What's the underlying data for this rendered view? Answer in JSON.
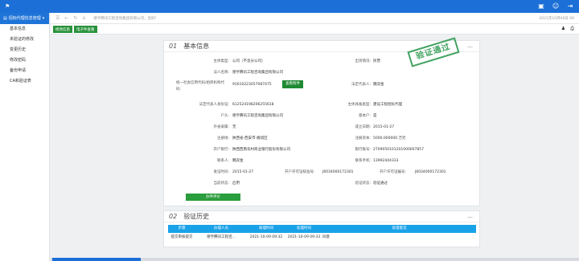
{
  "topbar": {
    "icons": [
      "monitor-icon",
      "user-icon",
      "exit-icon"
    ]
  },
  "sidebar": {
    "header": "招标代理信息管理",
    "items": [
      "基本信息",
      "未验证的修改",
      "变更历史",
      "修改密码",
      "备份申请",
      "CA和验证表"
    ]
  },
  "crumb": {
    "title": "德亨腾讯工程咨询集团有限公司，您好!",
    "date": "2021年10月09日 09"
  },
  "toolbar": {
    "btn1": "修改信息",
    "btn2": "电子件查看"
  },
  "basic": {
    "num": "01",
    "title": "基本信息",
    "stamp": "验证通过",
    "view_btn": "查看附件",
    "eval_btn": "办件评价",
    "fields": [
      {
        "label": "主体类型:",
        "value": "公司（不含分公司）",
        "label2": "出资情况:",
        "value2": "民营"
      },
      {
        "label": "法人名称:",
        "value": "德亨腾讯工程咨询集团有限公司",
        "label2": "",
        "value2": ""
      },
      {
        "label": "统一社会信用代码/组织机构代码:",
        "value": "91610223057087475",
        "label2": "法定代表人:",
        "value2": "魏双金"
      },
      {
        "label": "法定代表人身份证:",
        "value": "61252419820625561​8",
        "label2": "主体具备类型:",
        "value2": "建设工程招标代理"
      },
      {
        "label": "户头:",
        "value": "德亨腾讯工程咨询集团有限公司",
        "label2": "基本户:",
        "value2": "是"
      },
      {
        "label": "外省隶属:",
        "value": "无",
        "label2": "成立日期:",
        "value2": "2015-01-27"
      },
      {
        "label": "注册地:",
        "value": "陕西省-西安市-雁塔区",
        "label2": "注册资本:",
        "value2": "5000.000000 万元"
      },
      {
        "label": "开户银行:",
        "value": "陕西西南农村商业银行股份有限公司",
        "label2": "银行账号:",
        "value2": "2709050101201000007857"
      },
      {
        "label": "联系人:",
        "value": "魏双金",
        "label2": "联系手机:",
        "value2": "13992444333"
      }
    ],
    "approve_label": "发证时间:",
    "approve_value": "2015-01-27",
    "permit_label": "开户许可证核准号:",
    "permit_value": "J6034000172301",
    "permit_label2": "开户许可证编号:",
    "permit_value2": "J6034000172301",
    "status_label": "当前状态:",
    "status_value": "启用",
    "verify_label": "验证状态:",
    "verify_value": "验证通过"
  },
  "history": {
    "num": "02",
    "title": "验证历史",
    "columns": [
      "步骤",
      "办理人员",
      "收理时间",
      "处理时间",
      "处理意见"
    ],
    "rows": [
      [
        "提交审核提交",
        "德亨腾讯工程咨...",
        "2021-10-09 09:32",
        "2021-10-09 09:33",
        "同意"
      ]
    ]
  }
}
